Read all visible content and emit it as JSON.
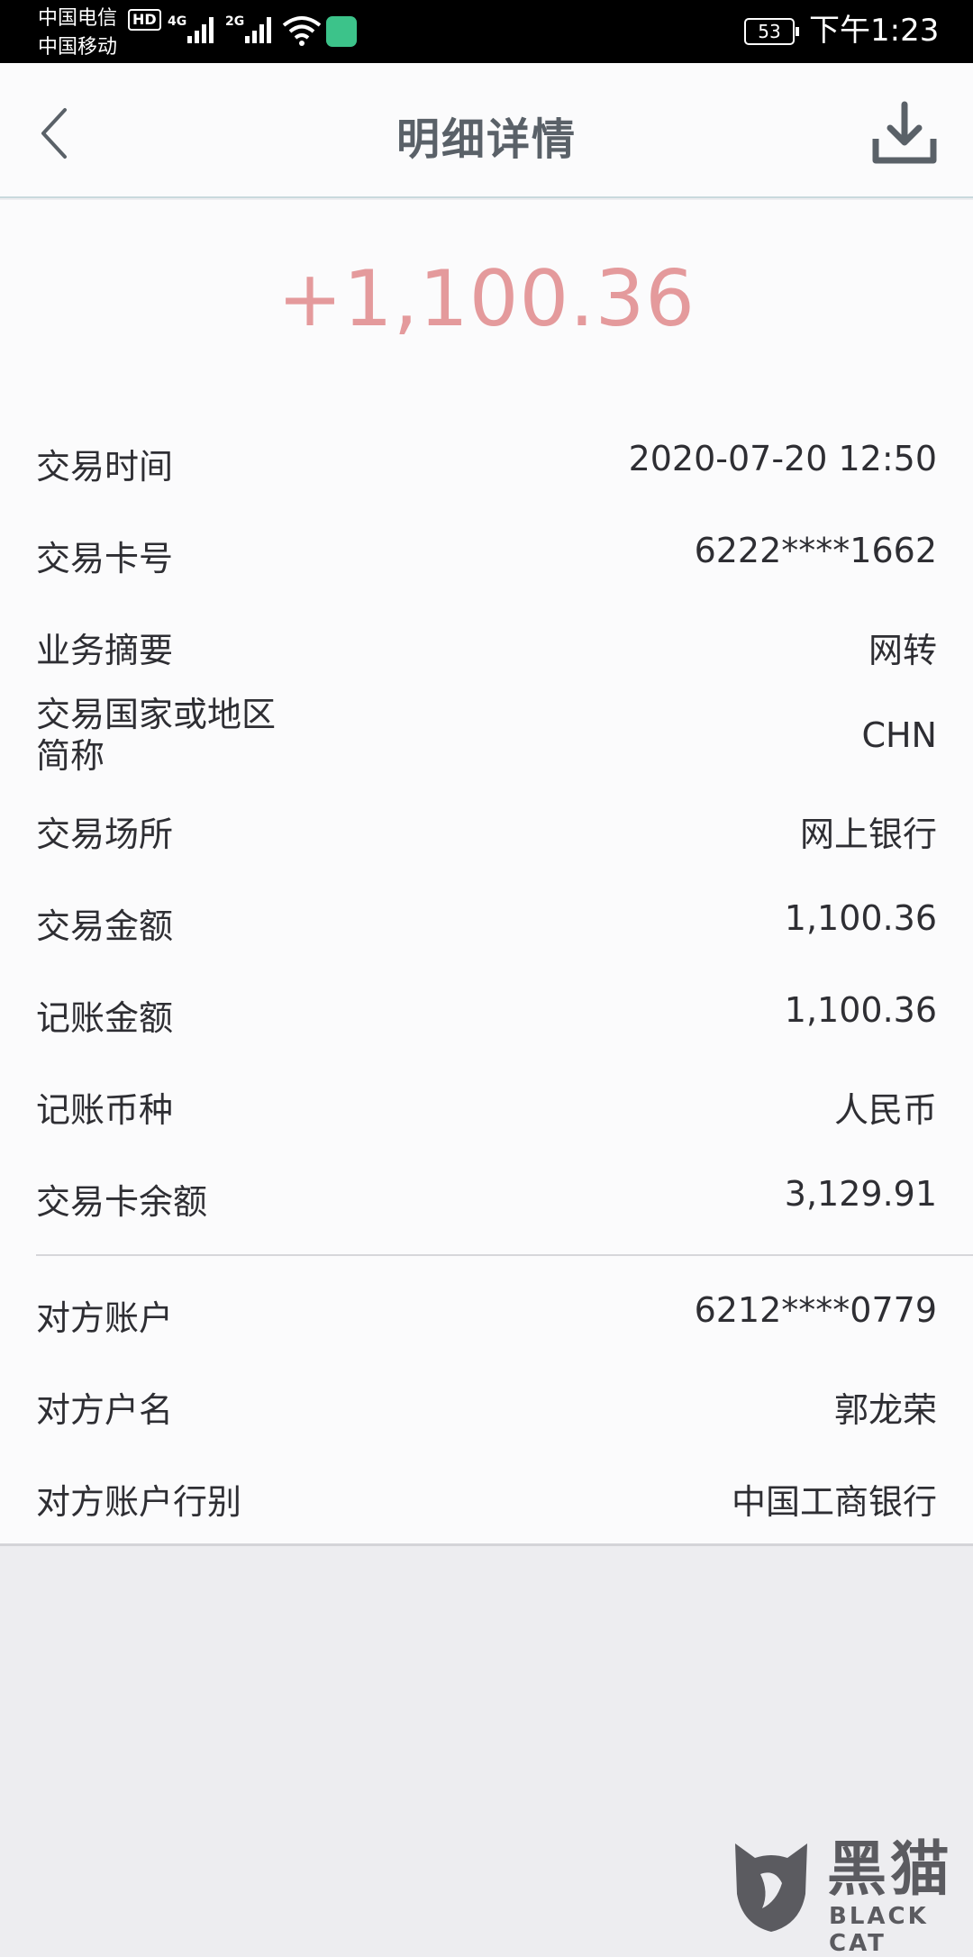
{
  "status_bar": {
    "carrier1": "中国电信",
    "hd_badge": "HD",
    "net1": "4G",
    "net2": "2G",
    "carrier2": "中国移动",
    "battery": "53",
    "time": "下午1:23",
    "icons": [
      "signal-icon",
      "wifi-icon",
      "app-notification-icon",
      "battery-icon"
    ]
  },
  "header": {
    "title": "明细详情",
    "back_icon": "chevron-left-icon",
    "download_icon": "download-icon"
  },
  "amount": "+1,100.36",
  "accent_color": "#e49a9c",
  "details": [
    {
      "label": "交易时间",
      "value": "2020-07-20 12:50"
    },
    {
      "label": "交易卡号",
      "value": "6222****1662"
    },
    {
      "label": "业务摘要",
      "value": "网转"
    },
    {
      "label_line1": "交易国家或地区",
      "label_line2": "简称",
      "value": "CHN"
    },
    {
      "label": "交易场所",
      "value": "网上银行"
    },
    {
      "label": "交易金额",
      "value": "1,100.36"
    },
    {
      "label": "记账金额",
      "value": "1,100.36"
    },
    {
      "label": "记账币种",
      "value": "人民币"
    },
    {
      "label": "交易卡余额",
      "value": "3,129.91"
    }
  ],
  "counterparty": [
    {
      "label": "对方账户",
      "value": "6212****0779"
    },
    {
      "label": "对方户名",
      "value": "郭龙荣"
    },
    {
      "label": "对方账户行别",
      "value": "中国工商银行"
    }
  ],
  "watermark": {
    "text_cn": "黑猫",
    "text_en": "BLACK CAT"
  }
}
